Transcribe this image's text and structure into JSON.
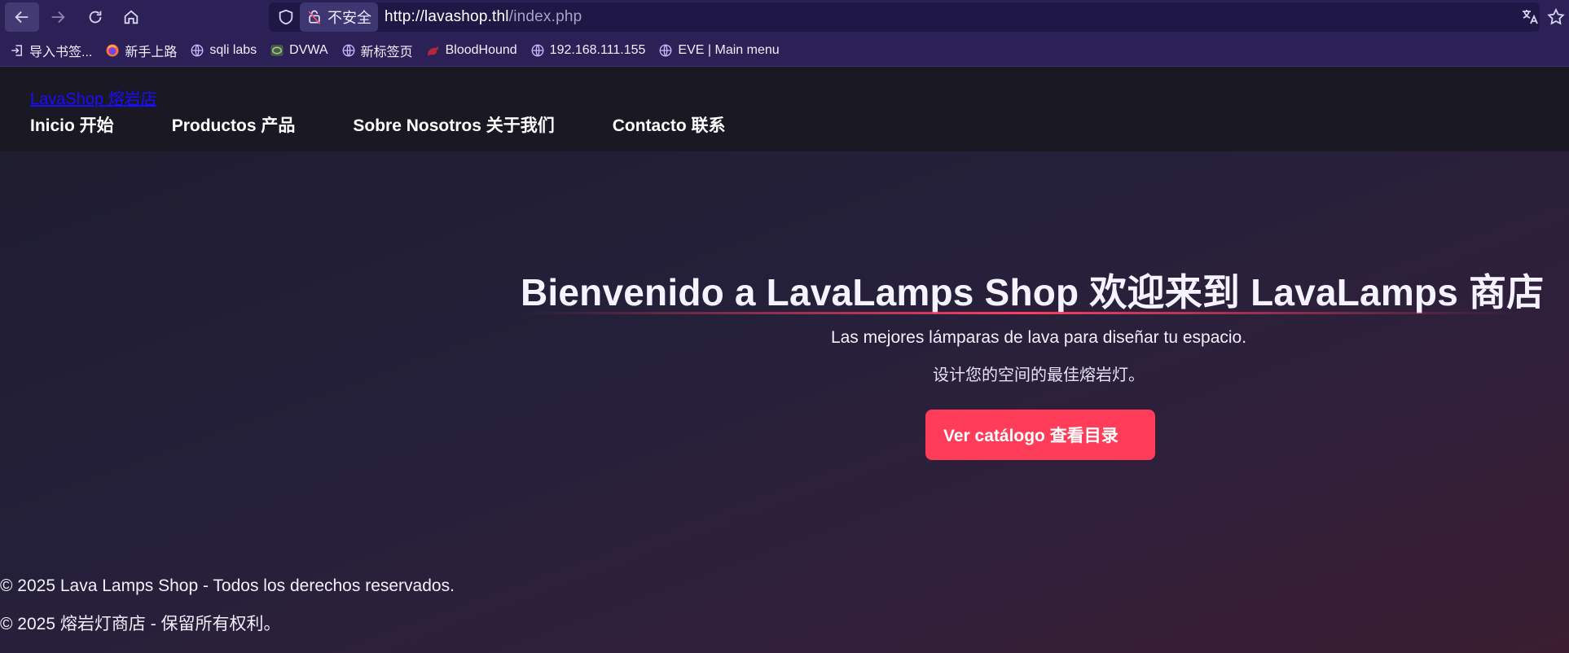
{
  "browser": {
    "security_label": "不安全",
    "url_host": "http://lavashop.thl",
    "url_path": "/index.php"
  },
  "bookmarks": [
    {
      "label": "导入书签...",
      "icon": "import-icon"
    },
    {
      "label": "新手上路",
      "icon": "firefox-icon"
    },
    {
      "label": "sqli labs",
      "icon": "globe-icon"
    },
    {
      "label": "DVWA",
      "icon": "dvwa-icon"
    },
    {
      "label": "新标签页",
      "icon": "globe-icon"
    },
    {
      "label": "BloodHound",
      "icon": "bloodhound-icon"
    },
    {
      "label": "192.168.111.155",
      "icon": "globe-icon"
    },
    {
      "label": "EVE | Main menu",
      "icon": "globe-icon"
    }
  ],
  "site": {
    "logo": "LavaShop  熔岩店",
    "nav": [
      "Inicio 开始",
      "Productos 产品",
      "Sobre Nosotros 关于我们",
      "Contacto 联系"
    ]
  },
  "hero": {
    "title": "Bienvenido a LavaLamps Shop 欢迎来到 LavaLamps 商店",
    "subtitle_es": "Las mejores lámparas de lava para diseñar tu espacio.",
    "subtitle_zh": "设计您的空间的最佳熔岩灯。",
    "cta": "Ver catálogo  查看目录"
  },
  "footer": {
    "line1": "© 2025 Lava Lamps Shop - Todos los derechos reservados.",
    "line2": "© 2025 熔岩灯商店 - 保留所有权利。"
  },
  "colors": {
    "browser_chrome": "#2b2156",
    "accent": "#ff3d5a",
    "logo_link": "#1a0dff"
  }
}
